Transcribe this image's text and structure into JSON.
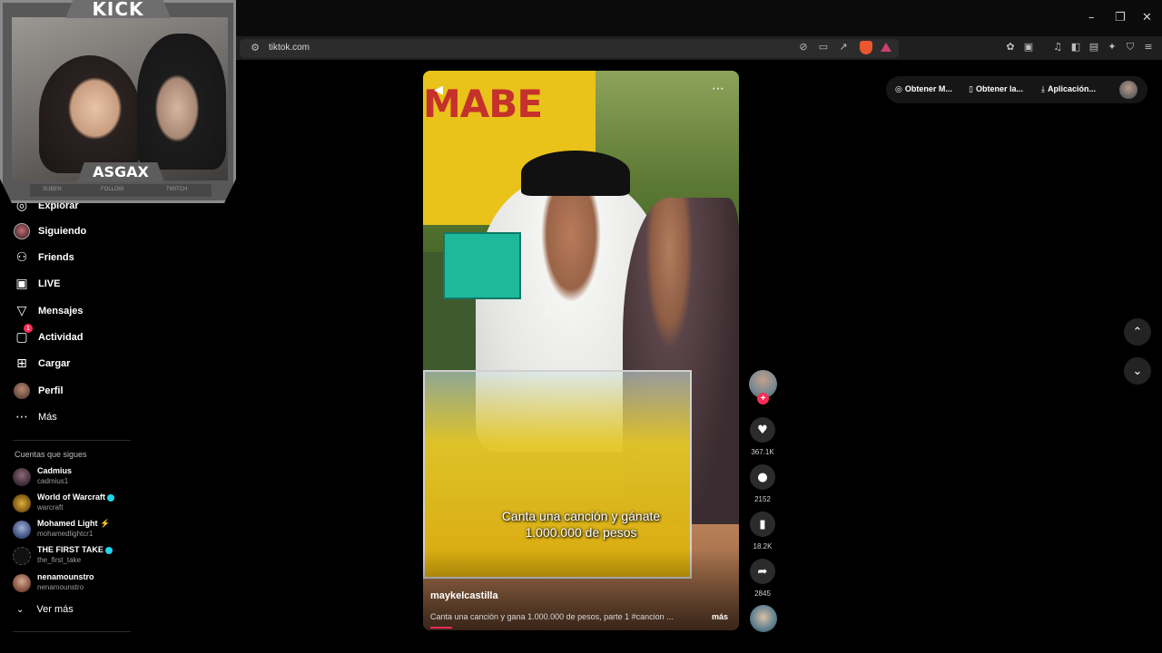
{
  "browser": {
    "url": "tiktok.com",
    "window_controls": [
      "–",
      "❐",
      "✕"
    ]
  },
  "webcam": {
    "platform": "KICK",
    "streamer": "ASGAX",
    "bar_labels": [
      "SUBEN",
      "FOLLOW",
      "TWITCH"
    ]
  },
  "sidebar": {
    "nav": [
      {
        "label": "Explorar",
        "icon": "compass-icon"
      },
      {
        "label": "Siguiendo",
        "icon": "following-avatar-icon"
      },
      {
        "label": "Friends",
        "icon": "friends-icon"
      },
      {
        "label": "LIVE",
        "icon": "live-icon"
      },
      {
        "label": "Mensajes",
        "icon": "send-icon"
      },
      {
        "label": "Actividad",
        "icon": "activity-icon",
        "badge": "1"
      },
      {
        "label": "Cargar",
        "icon": "upload-icon"
      },
      {
        "label": "Perfil",
        "icon": "profile-avatar-icon"
      },
      {
        "label": "Más",
        "icon": "more-icon"
      }
    ],
    "following_title": "Cuentas que sigues",
    "accounts": [
      {
        "name": "Cadmius",
        "username": "cadmius1",
        "verified": false,
        "lightning": false
      },
      {
        "name": "World of Warcraft",
        "username": "warcraft",
        "verified": true,
        "lightning": false
      },
      {
        "name": "Mohamed Light",
        "username": "mohamedlightcr1",
        "verified": false,
        "lightning": true
      },
      {
        "name": "THE FIRST TAKE",
        "username": "the_first_take",
        "verified": true,
        "lightning": false
      },
      {
        "name": "nenamounstro",
        "username": "nenamounstro",
        "verified": false,
        "lightning": false
      }
    ],
    "see_more": "Ver más"
  },
  "video": {
    "sign_text": "MABE",
    "caption_line1": "Canta una canción y gánate",
    "caption_line2": "1.000.000 de pesos",
    "author": "maykelcastilla",
    "description": "Canta una canción y gana 1.000.000 de pesos, parte 1  #cancion ...",
    "more": "más"
  },
  "actions": {
    "likes": "367.1K",
    "comments": "2152",
    "saves": "18.2K",
    "shares": "2845"
  },
  "top_bar": {
    "items": [
      "Obtener M...",
      "Obtener la...",
      "Aplicación..."
    ]
  },
  "colors": {
    "accent": "#fe2c55",
    "verified": "#20d5ec",
    "background": "#000000"
  }
}
